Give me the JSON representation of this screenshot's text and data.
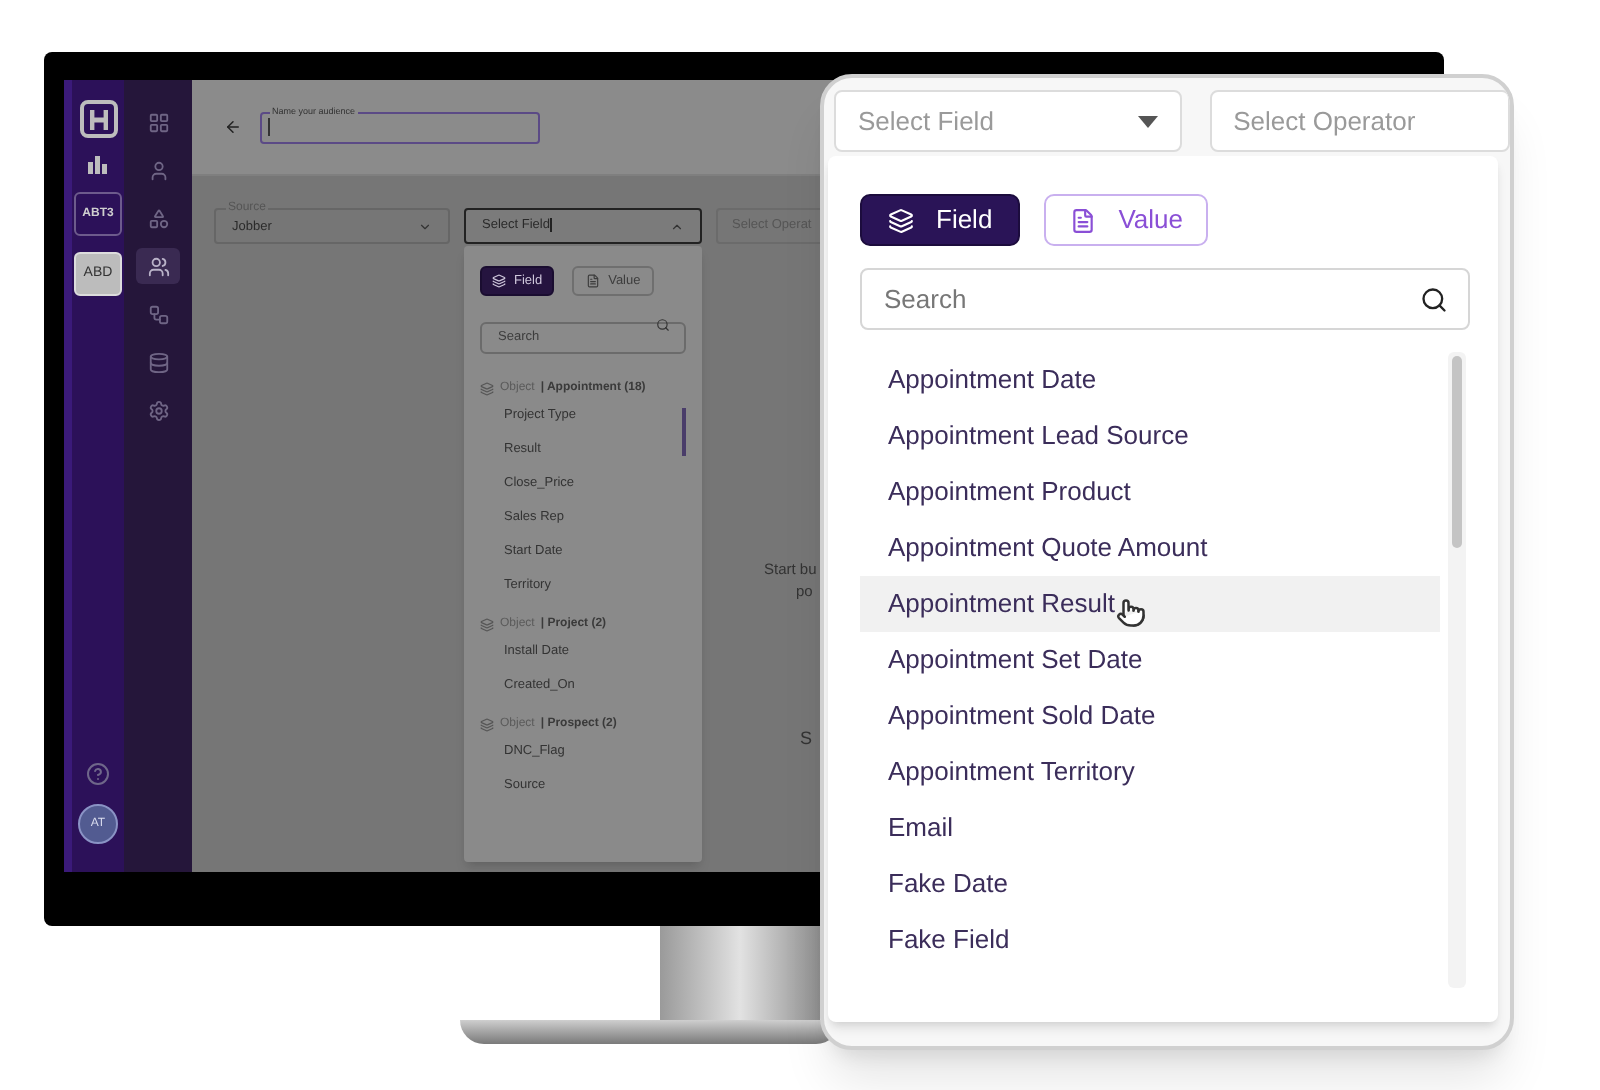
{
  "rail": {
    "items": [
      {
        "label": "ABT3",
        "selected": false
      },
      {
        "label": "ABD",
        "selected": true
      }
    ],
    "avatar": "AT"
  },
  "nav": [
    {
      "kind": "grid",
      "selected": false
    },
    {
      "kind": "user",
      "selected": false
    },
    {
      "kind": "shapes",
      "selected": false
    },
    {
      "kind": "users",
      "selected": true
    },
    {
      "kind": "flow",
      "selected": false
    },
    {
      "kind": "database",
      "selected": false
    },
    {
      "kind": "settings",
      "selected": false
    }
  ],
  "header": {
    "audience_label": "Name your audience"
  },
  "filters": {
    "source": {
      "label": "Source",
      "value": "Jobber"
    },
    "field": {
      "value": "Select Field"
    },
    "operator": {
      "placeholder": "Select Operat"
    }
  },
  "field_dropdown": {
    "tabs": [
      {
        "label": "Field",
        "kind": "field",
        "selected": true
      },
      {
        "label": "Value",
        "kind": "value",
        "selected": false
      }
    ],
    "search": {
      "placeholder": "Search"
    },
    "groups": [
      {
        "prefix": "Object",
        "name": "| Appointment (18)",
        "items": [
          "Project Type",
          "Result",
          "Close_Price",
          "Sales Rep",
          "Start Date",
          "Territory"
        ]
      },
      {
        "prefix": "Object",
        "name": "| Project (2)",
        "items": [
          "Install Date",
          "Created_On"
        ]
      },
      {
        "prefix": "Object",
        "name": "| Prospect (2)",
        "items": [
          "DNC_Flag",
          "Source"
        ]
      }
    ]
  },
  "empty_state": {
    "line_1": "Start bu",
    "line_2": "po",
    "line_3": "S"
  },
  "zoom_card": {
    "field_select": {
      "placeholder": "Select Field"
    },
    "operator_select": {
      "placeholder": "Select Operator"
    },
    "tabs": [
      {
        "label": "Field",
        "kind": "field",
        "selected": true
      },
      {
        "label": "Value",
        "kind": "value",
        "selected": false
      }
    ],
    "search": {
      "placeholder": "Search"
    },
    "items": [
      {
        "label": "Appointment Date",
        "hovered": false
      },
      {
        "label": "Appointment Lead Source",
        "hovered": false
      },
      {
        "label": "Appointment Product",
        "hovered": false
      },
      {
        "label": "Appointment Quote Amount",
        "hovered": false
      },
      {
        "label": "Appointment Result",
        "hovered": true
      },
      {
        "label": "Appointment Set Date",
        "hovered": false
      },
      {
        "label": "Appointment Sold Date",
        "hovered": false
      },
      {
        "label": "Appointment Territory",
        "hovered": false
      },
      {
        "label": "Email",
        "hovered": false
      },
      {
        "label": "Fake Date",
        "hovered": false
      },
      {
        "label": "Fake Field",
        "hovered": false
      }
    ]
  }
}
